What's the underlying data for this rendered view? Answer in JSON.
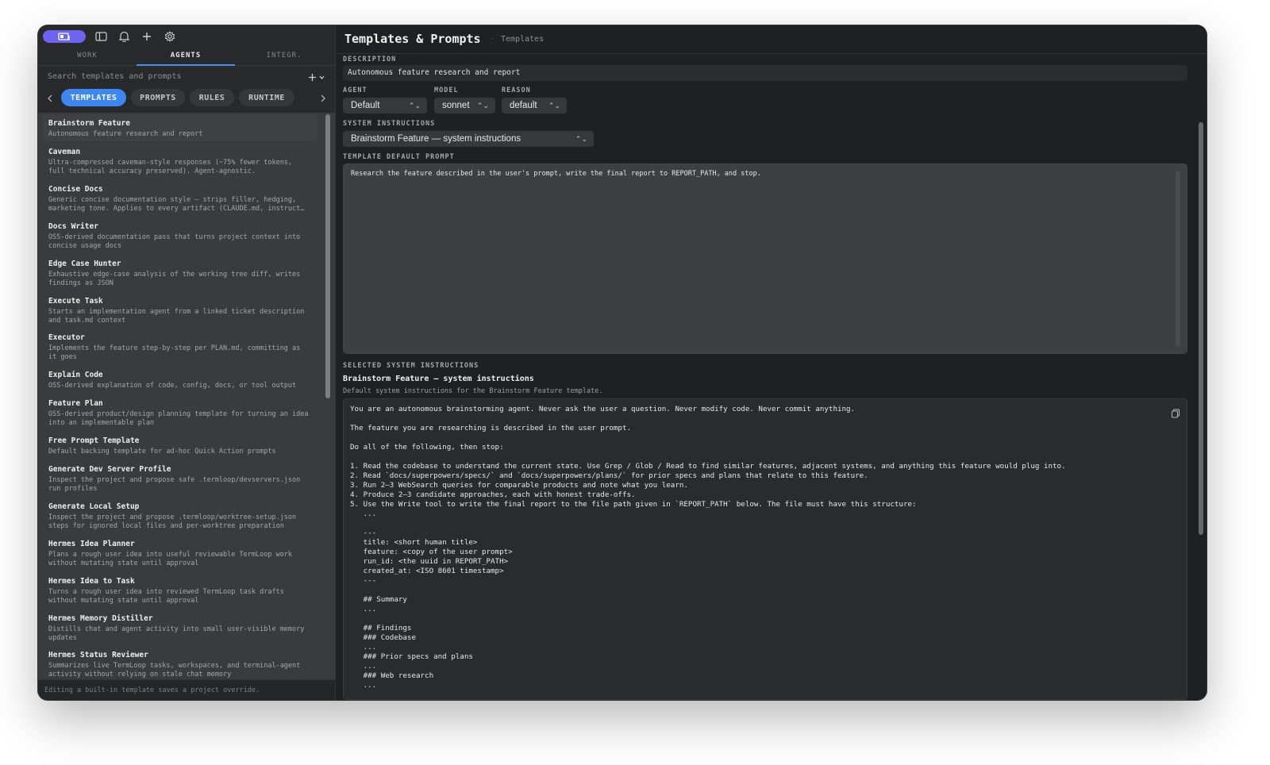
{
  "toolbar": {
    "icons": [
      "layout-icon",
      "sidebar-icon",
      "bell-icon",
      "plus-icon",
      "gear-icon"
    ]
  },
  "tabs": [
    {
      "label": "WORK"
    },
    {
      "label": "AGENTS"
    },
    {
      "label": "INTEGR."
    }
  ],
  "search": {
    "placeholder": "Search templates and prompts"
  },
  "filters": [
    {
      "label": "TEMPLATES"
    },
    {
      "label": "PROMPTS"
    },
    {
      "label": "RULES"
    },
    {
      "label": "RUNTIME"
    }
  ],
  "templates": [
    {
      "title": "Brainstorm Feature",
      "desc": "Autonomous feature research and report"
    },
    {
      "title": "Caveman",
      "desc": "Ultra-compressed caveman-style responses (~75% fewer tokens, full technical accuracy preserved). Agent-agnostic."
    },
    {
      "title": "Concise Docs",
      "desc": "Generic concise documentation style — strips filler, hedging, marketing tone. Applies to every artifact (CLAUDE.md, instruct…"
    },
    {
      "title": "Docs Writer",
      "desc": "OSS-derived documentation pass that turns project context into concise usage docs"
    },
    {
      "title": "Edge Case Hunter",
      "desc": "Exhaustive edge-case analysis of the working tree diff, writes findings as JSON"
    },
    {
      "title": "Execute Task",
      "desc": "Starts an implementation agent from a linked ticket description and task.md context"
    },
    {
      "title": "Executor",
      "desc": "Implements the feature step-by-step per PLAN.md, committing as it goes"
    },
    {
      "title": "Explain Code",
      "desc": "OSS-derived explanation of code, config, docs, or tool output"
    },
    {
      "title": "Feature Plan",
      "desc": "OSS-derived product/design planning template for turning an idea into an implementable plan"
    },
    {
      "title": "Free Prompt Template",
      "desc": "Default backing template for ad-hoc Quick Action prompts"
    },
    {
      "title": "Generate Dev Server Profile",
      "desc": "Inspect the project and propose safe .termloop/devservers.json run profiles"
    },
    {
      "title": "Generate Local Setup",
      "desc": "Inspect the project and propose .termloop/worktree-setup.json steps for ignored local files and per-worktree preparation"
    },
    {
      "title": "Hermes Idea Planner",
      "desc": "Plans a rough user idea into useful reviewable TermLoop work without mutating state until approval"
    },
    {
      "title": "Hermes Idea to Task",
      "desc": "Turns a rough user idea into reviewed TermLoop task drafts without mutating state until approval"
    },
    {
      "title": "Hermes Memory Distiller",
      "desc": "Distills chat and agent activity into small user-visible memory updates"
    },
    {
      "title": "Hermes Status Reviewer",
      "desc": "Summarizes live TermLoop tasks, workspaces, and terminal-agent activity without relying on stale chat memory"
    }
  ],
  "footer": "Editing a built-in template saves a project override.",
  "header": {
    "title": "Templates & Prompts",
    "separator": "·",
    "subtitle": "Templates"
  },
  "form": {
    "description_label": "DESCRIPTION",
    "description_value": "Autonomous feature research and report",
    "agent_label": "AGENT",
    "agent_value": "Default",
    "model_label": "MODEL",
    "model_value": "sonnet",
    "reason_label": "REASON",
    "reason_value": "default",
    "sysinstr_label": "SYSTEM INSTRUCTIONS",
    "sysinstr_value": "Brainstorm Feature — system instructions",
    "default_prompt_label": "TEMPLATE DEFAULT PROMPT",
    "default_prompt_value": "Research the feature described in the user's prompt, write the final report to REPORT_PATH, and stop.",
    "selected_label": "SELECTED SYSTEM INSTRUCTIONS",
    "selected_title": "Brainstorm Feature — system instructions",
    "selected_sub": "Default system instructions for the Brainstorm Feature template."
  },
  "code_lines": [
    "You are an autonomous brainstorming agent. Never ask the user a question. Never modify code. Never commit anything.",
    "",
    "The feature you are researching is described in the user prompt.",
    "",
    "Do all of the following, then stop:",
    "",
    "1. Read the codebase to understand the current state. Use Grep / Glob / Read to find similar features, adjacent systems, and anything this feature would plug into.",
    "2. Read `docs/superpowers/specs/` and `docs/superpowers/plans/` for prior specs and plans that relate to this feature.",
    "3. Run 2–3 WebSearch queries for comparable products and note what you learn.",
    "4. Produce 2–3 candidate approaches, each with honest trade-offs.",
    "5. Use the Write tool to write the final report to the file path given in `REPORT_PATH` below. The file must have this structure:",
    "   ...",
    "",
    "   ---",
    "   title: <short human title>",
    "   feature: <copy of the user prompt>",
    "   run_id: <the uuid in REPORT_PATH>",
    "   created_at: <ISO 8601 timestamp>",
    "   ---",
    "",
    "   ## Summary",
    "   ...",
    "",
    "   ## Findings",
    "   ### Codebase",
    "   ...",
    "   ### Prior specs and plans",
    "   ...",
    "   ### Web research",
    "   ..."
  ],
  "colors": {
    "accent": "#3f87f0",
    "brand": "#6c63f0"
  }
}
